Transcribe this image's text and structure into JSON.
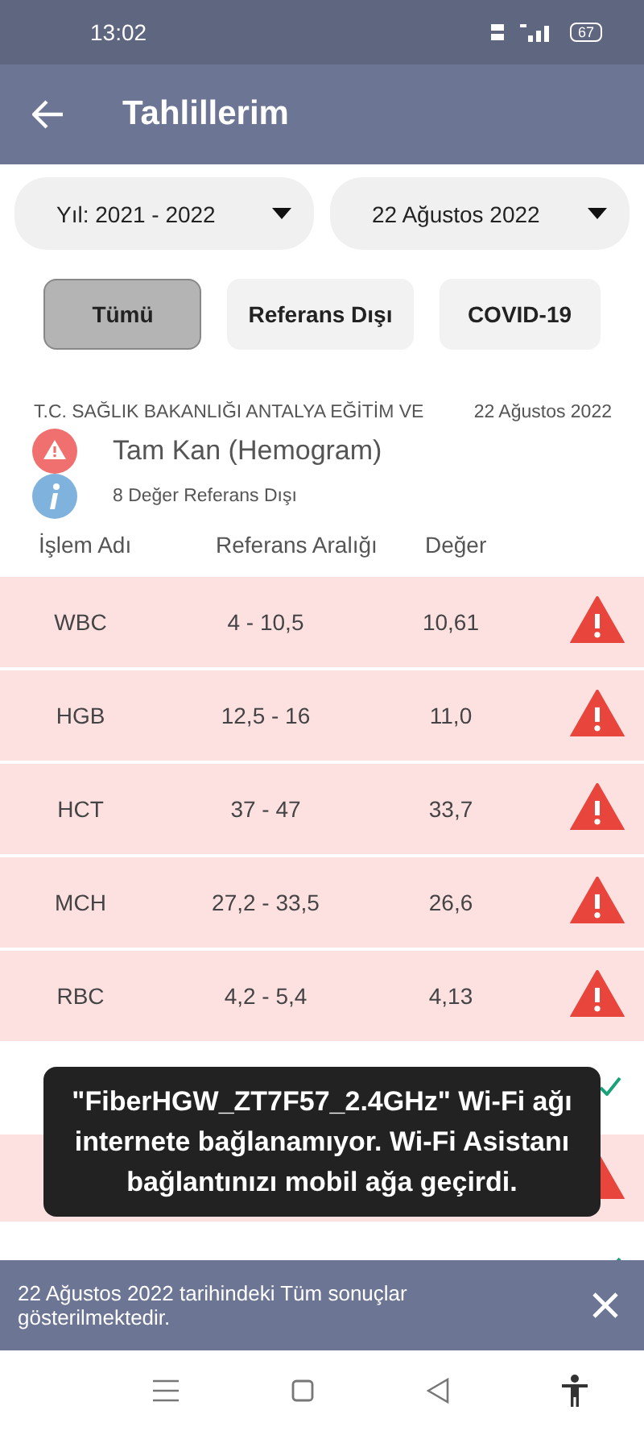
{
  "status_bar": {
    "time": "13:02",
    "battery": "67"
  },
  "header": {
    "title": "Tahlillerim"
  },
  "dropdowns": [
    {
      "label": "Yıl: 2021 - 2022"
    },
    {
      "label": "22 Ağustos 2022"
    }
  ],
  "filters": [
    {
      "label": "Tümü",
      "selected": true
    },
    {
      "label": "Referans Dışı",
      "selected": false
    },
    {
      "label": "COVID-19",
      "selected": false
    }
  ],
  "result": {
    "source": "T.C. SAĞLIK BAKANLIĞI ANTALYA EĞİTİM VE",
    "date": "22 Ağustos 2022",
    "test_name": "Tam Kan (Hemogram)",
    "summary": "8 Değer Referans Dışı"
  },
  "table": {
    "columns": [
      "İşlem Adı",
      "Referans Aralığı",
      "Değer"
    ],
    "rows": [
      {
        "name": "WBC",
        "range": "4 - 10,5",
        "value": "10,61",
        "out_of_range": true
      },
      {
        "name": "HGB",
        "range": "12,5 - 16",
        "value": "11,0",
        "out_of_range": true
      },
      {
        "name": "HCT",
        "range": "37 - 47",
        "value": "33,7",
        "out_of_range": true
      },
      {
        "name": "MCH",
        "range": "27,2 - 33,5",
        "value": "26,6",
        "out_of_range": true
      },
      {
        "name": "RBC",
        "range": "4,2 - 5,4",
        "value": "4,13",
        "out_of_range": true
      },
      {
        "out_of_range": false
      },
      {
        "out_of_range": true
      },
      {
        "out_of_range": false
      }
    ]
  },
  "toast": {
    "text": "\"FiberHGW_ZT7F57_2.4GHz\" Wi-Fi ağı internete bağlanamıyor. Wi-Fi Asistanı bağlantınızı mobil ağa geçirdi."
  },
  "snackbar": {
    "text": "22 Ağustos 2022 tarihindeki Tüm sonuçlar gösterilmektedir."
  }
}
